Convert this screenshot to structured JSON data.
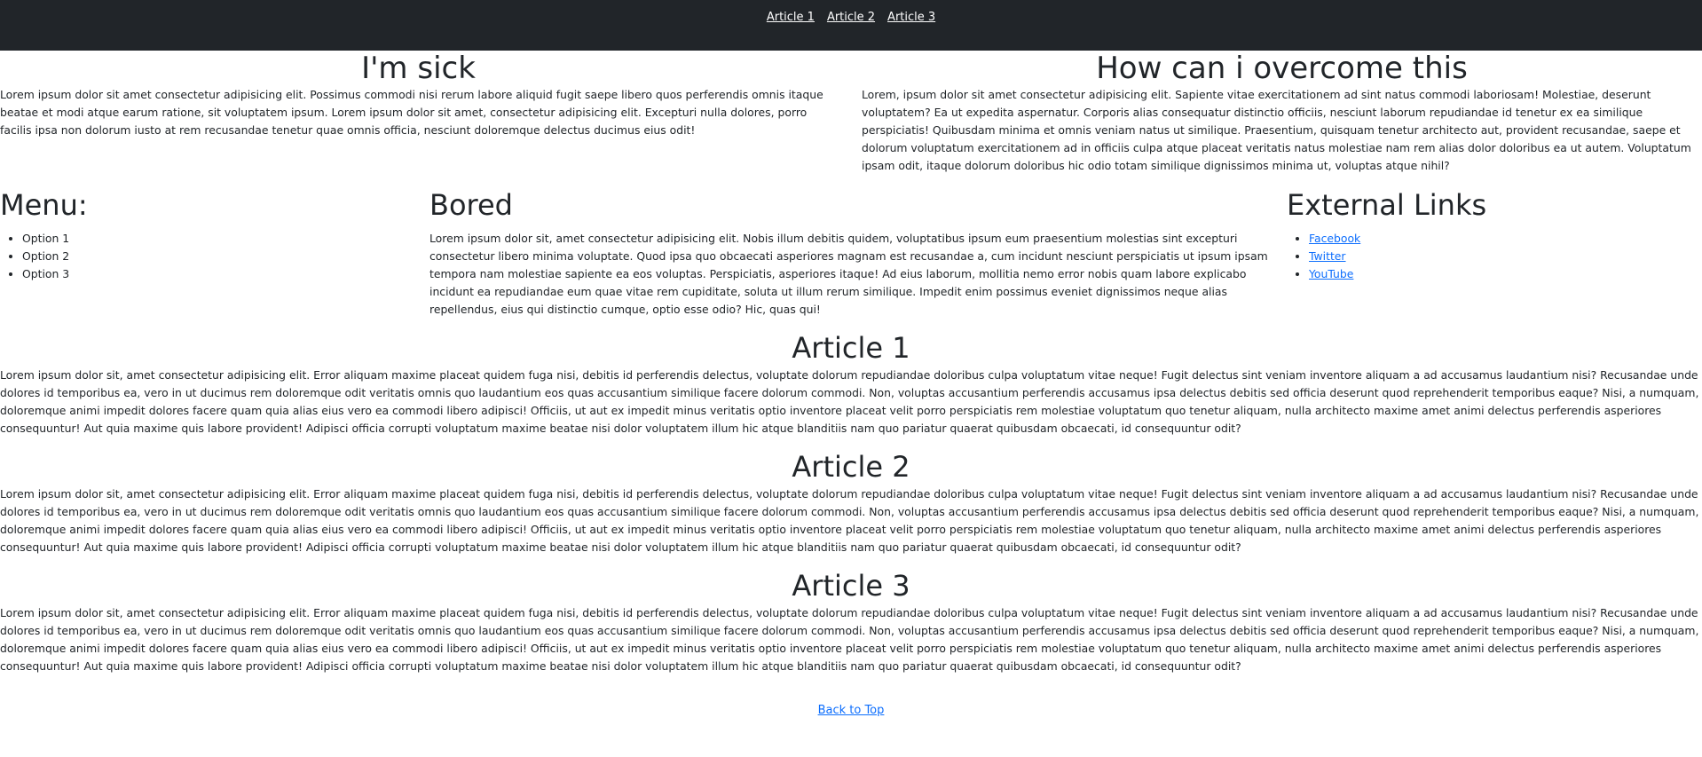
{
  "nav": {
    "links": [
      "Article 1",
      "Article 2",
      "Article 3"
    ]
  },
  "intro": {
    "left": {
      "title": "I'm sick",
      "text": "Lorem ipsum dolor sit amet consectetur adipisicing elit. Possimus commodi nisi rerum labore aliquid fugit saepe libero quos perferendis omnis itaque beatae et modi atque earum ratione, sit voluptatem ipsum. Lorem ipsum dolor sit amet, consectetur adipisicing elit. Excepturi nulla dolores, porro facilis ipsa non dolorum iusto at rem recusandae tenetur quae omnis officia, nesciunt doloremque delectus ducimus eius odit!"
    },
    "right": {
      "title": "How can i overcome this",
      "text": "Lorem, ipsum dolor sit amet consectetur adipisicing elit. Sapiente vitae exercitationem ad sint natus commodi laboriosam! Molestiae, deserunt voluptatem? Ea ut expedita aspernatur. Corporis alias consequatur distinctio officiis, nesciunt laborum repudiandae id tenetur ex ea similique perspiciatis! Quibusdam minima et omnis veniam natus ut similique. Praesentium, quisquam tenetur architecto aut, provident recusandae, saepe et dolorum voluptatum exercitationem ad in officiis culpa atque placeat veritatis natus molestiae nam rem alias dolor doloribus ea ut autem. Voluptatum ipsam odit, itaque dolorum doloribus hic odio totam similique dignissimos minima ut, voluptas atque nihil?"
    }
  },
  "menu": {
    "title": "Menu:",
    "options": [
      "Option 1",
      "Option 2",
      "Option 3"
    ]
  },
  "bored": {
    "title": "Bored",
    "text": "Lorem ipsum dolor sit, amet consectetur adipisicing elit. Nobis illum debitis quidem, voluptatibus ipsum eum praesentium molestias sint excepturi consectetur libero minima voluptate. Quod ipsa quo obcaecati asperiores magnam est recusandae a, cum incidunt nesciunt perspiciatis ut ipsum ipsam tempora nam molestiae sapiente ea eos voluptas. Perspiciatis, asperiores itaque! Ad eius laborum, mollitia nemo error nobis quam labore explicabo incidunt ea repudiandae eum quae vitae rem cupiditate, soluta ut illum rerum similique. Impedit enim possimus eveniet dignissimos neque alias repellendus, eius qui distinctio cumque, optio esse odio? Hic, quas qui!"
  },
  "external": {
    "title": "External Links",
    "links": [
      "Facebook",
      "Twitter",
      "YouTube"
    ]
  },
  "articles": [
    {
      "title": "Article 1",
      "text": "Lorem ipsum dolor sit, amet consectetur adipisicing elit. Error aliquam maxime placeat quidem fuga nisi, debitis id perferendis delectus, voluptate dolorum repudiandae doloribus culpa voluptatum vitae neque! Fugit delectus sint veniam inventore aliquam a ad accusamus laudantium nisi? Recusandae unde dolores id temporibus ea, vero in ut ducimus rem doloremque odit veritatis omnis quo laudantium eos quas accusantium similique facere dolorum commodi. Non, voluptas accusantium perferendis accusamus ipsa delectus debitis sed officia deserunt quod reprehenderit temporibus eaque? Nisi, a numquam, doloremque animi impedit dolores facere quam quia alias eius vero ea commodi libero adipisci! Officiis, ut aut ex impedit minus veritatis optio inventore placeat velit porro perspiciatis rem molestiae voluptatum quo tenetur aliquam, nulla architecto maxime amet animi delectus perferendis asperiores consequuntur! Aut quia maxime quis labore provident! Adipisci officia corrupti voluptatum maxime beatae nisi dolor voluptatem illum hic atque blanditiis nam quo pariatur quaerat quibusdam obcaecati, id consequuntur odit?"
    },
    {
      "title": "Article 2",
      "text": "Lorem ipsum dolor sit, amet consectetur adipisicing elit. Error aliquam maxime placeat quidem fuga nisi, debitis id perferendis delectus, voluptate dolorum repudiandae doloribus culpa voluptatum vitae neque! Fugit delectus sint veniam inventore aliquam a ad accusamus laudantium nisi? Recusandae unde dolores id temporibus ea, vero in ut ducimus rem doloremque odit veritatis omnis quo laudantium eos quas accusantium similique facere dolorum commodi. Non, voluptas accusantium perferendis accusamus ipsa delectus debitis sed officia deserunt quod reprehenderit temporibus eaque? Nisi, a numquam, doloremque animi impedit dolores facere quam quia alias eius vero ea commodi libero adipisci! Officiis, ut aut ex impedit minus veritatis optio inventore placeat velit porro perspiciatis rem molestiae voluptatum quo tenetur aliquam, nulla architecto maxime amet animi delectus perferendis asperiores consequuntur! Aut quia maxime quis labore provident! Adipisci officia corrupti voluptatum maxime beatae nisi dolor voluptatem illum hic atque blanditiis nam quo pariatur quaerat quibusdam obcaecati, id consequuntur odit?"
    },
    {
      "title": "Article 3",
      "text": "Lorem ipsum dolor sit, amet consectetur adipisicing elit. Error aliquam maxime placeat quidem fuga nisi, debitis id perferendis delectus, voluptate dolorum repudiandae doloribus culpa voluptatum vitae neque! Fugit delectus sint veniam inventore aliquam a ad accusamus laudantium nisi? Recusandae unde dolores id temporibus ea, vero in ut ducimus rem doloremque odit veritatis omnis quo laudantium eos quas accusantium similique facere dolorum commodi. Non, voluptas accusantium perferendis accusamus ipsa delectus debitis sed officia deserunt quod reprehenderit temporibus eaque? Nisi, a numquam, doloremque animi impedit dolores facere quam quia alias eius vero ea commodi libero adipisci! Officiis, ut aut ex impedit minus veritatis optio inventore placeat velit porro perspiciatis rem molestiae voluptatum quo tenetur aliquam, nulla architecto maxime amet animi delectus perferendis asperiores consequuntur! Aut quia maxime quis labore provident! Adipisci officia corrupti voluptatum maxime beatae nisi dolor voluptatem illum hic atque blanditiis nam quo pariatur quaerat quibusdam obcaecati, id consequuntur odit?"
    }
  ],
  "footer": {
    "back_to_top": "Back to Top"
  },
  "colors": {
    "nav_bg": "#212529",
    "link": "#0d6efd",
    "text": "#212529"
  }
}
